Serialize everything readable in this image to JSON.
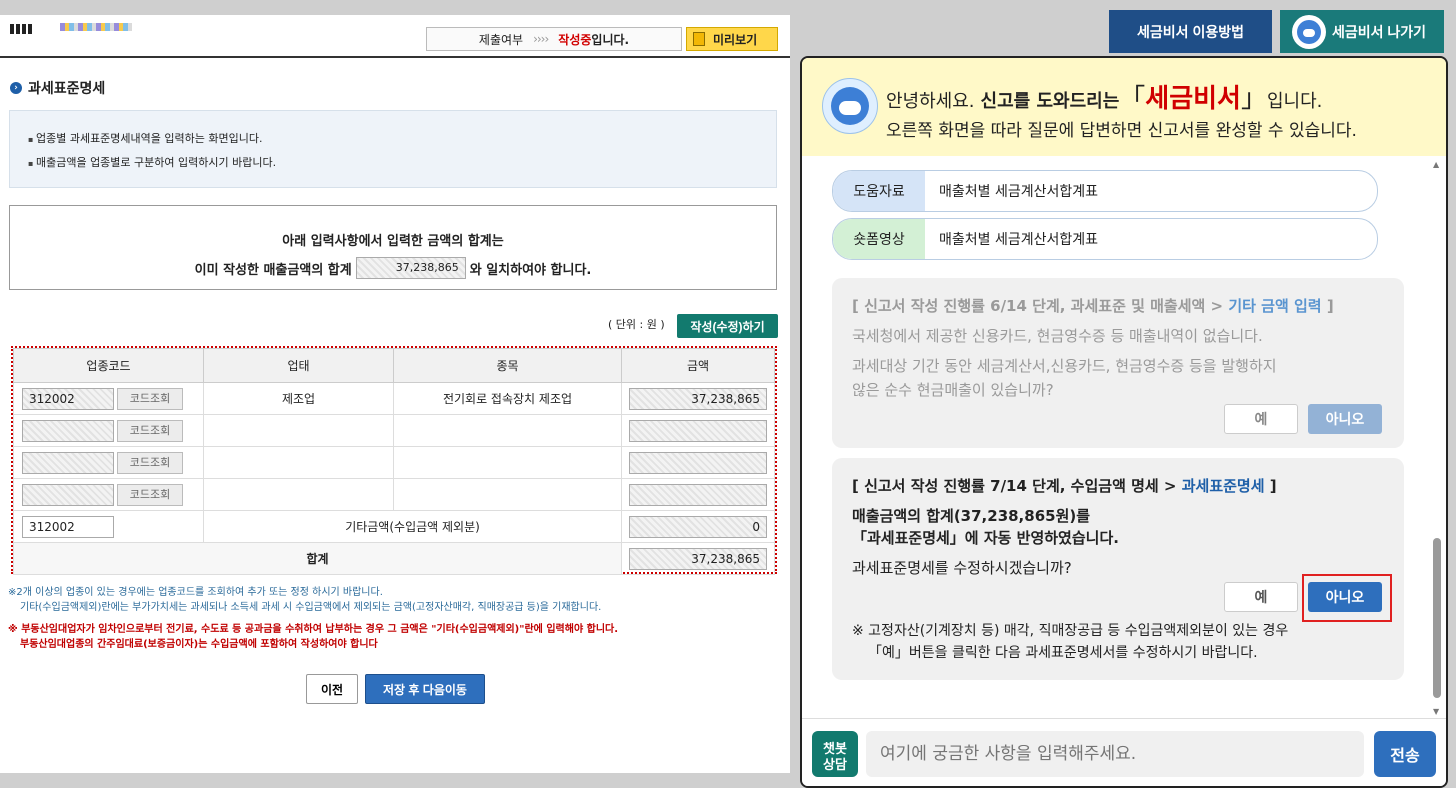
{
  "form": {
    "status_label": "제출여부",
    "status_arrows": "››››",
    "status_value": "작성중",
    "status_suffix": "입니다.",
    "preview_label": "미리보기",
    "section_title": "과세표준명세",
    "info_lines": [
      "업종별 과세표준명세내역을 입력하는 화면입니다.",
      "매출금액을 업종별로 구분하여 입력하시기 바랍니다."
    ],
    "notice_line1": "아래 입력사항에서  입력한 금액의 합계는",
    "notice_pre": "이미 작성한 매출금액의 합계",
    "notice_amount": "37,238,865",
    "notice_post": "와 일치하여야 합니다.",
    "unit_label": "( 단위 : 원 )",
    "write_button": "작성(수정)하기",
    "table": {
      "headers": [
        "업종코드",
        "업태",
        "종목",
        "금액"
      ],
      "code_lookup_label": "코드조회",
      "rows": [
        {
          "code": "312002",
          "type": "제조업",
          "item": "전기회로 접속장치 제조업",
          "amount": "37,238,865"
        },
        {
          "code": "",
          "type": "",
          "item": "",
          "amount": ""
        },
        {
          "code": "",
          "type": "",
          "item": "",
          "amount": ""
        },
        {
          "code": "",
          "type": "",
          "item": "",
          "amount": ""
        }
      ],
      "other_row": {
        "code": "312002",
        "label": "기타금액(수입금액 제외분)",
        "amount": "0"
      },
      "total_label": "합계",
      "total_amount": "37,238,865"
    },
    "footnote1_l1": "※2개 이상의 업종이 있는 경우에는 업종코드를 조회하여 추가 또는 정정 하시기 바랍니다.",
    "footnote1_l2": "기타(수입금액제외)란에는 부가가치세는 과세되나 소득세 과세 시 수입금액에서 제외되는 금액(고정자산매각, 직매장공급 등)을 기재합니다.",
    "footnote2_l1": "※ 부동산임대업자가 임차인으로부터 전기료, 수도료 등 공과금을 수취하여 납부하는 경우  그 금액은 \"기타(수입금액제외)\"란에 입력해야 합니다.",
    "footnote2_l2": "부동산임대업종의 간주임대료(보증금이자)는 수입금액에 포함하여 작성하여야 합니다",
    "prev_button": "이전",
    "next_button": "저장 후 다음이동"
  },
  "top_buttons": {
    "howto": "세금비서 이용방법",
    "exit": "세금비서 나가기"
  },
  "chat": {
    "greet_pre": "안녕하세요.",
    "greet_bold": "신고를 도와드리는",
    "brand_open": "「",
    "brand": "세금비서",
    "brand_close": "」",
    "greet_post": "입니다.",
    "greet_line2": "오른쪽 화면을 따라 질문에 답변하면 신고서를 완성할 수 있습니다.",
    "links": [
      {
        "tag": "도움자료",
        "text": "매출처별 세금계산서합계표"
      },
      {
        "tag": "숏폼영상",
        "text": "매출처별 세금계산서합계표"
      }
    ],
    "old_msg": {
      "stage_pre": "[ 신고서 작성 진행률 6/14 단계, 과세표준 및 매출세액 >",
      "stage_link": "기타 금액 입력",
      "stage_post": "]",
      "line1": "국세청에서 제공한 신용카드, 현금영수증 등 매출내역이 없습니다.",
      "line2": "과세대상 기간 동안 세금계산서,신용카드, 현금영수증 등을 발행하지",
      "line3": "않은 순수 현금매출이 있습니까?",
      "yes": "예",
      "no": "아니오"
    },
    "cur_msg": {
      "stage_pre": "[ 신고서 작성 진행률 7/14 단계, 수입금액 명세 >",
      "stage_link": "과세표준명세",
      "stage_post": "]",
      "line1": "매출금액의 합계(37,238,865원)를",
      "line2": "「과세표준명세」에 자동 반영하였습니다.",
      "line3": "과세표준명세를 수정하시겠습니까?",
      "yes": "예",
      "no": "아니오",
      "note1": "※ 고정자산(기계장치 등) 매각, 직매장공급 등 수입금액제외분이 있는 경우",
      "note2": "「예」버튼을 클릭한 다음 과세표준명세서를 수정하시기 바랍니다."
    },
    "chatbot_label_1": "챗봇",
    "chatbot_label_2": "상담",
    "input_placeholder": "여기에 궁금한 사항을 입력해주세요.",
    "send": "전송"
  }
}
